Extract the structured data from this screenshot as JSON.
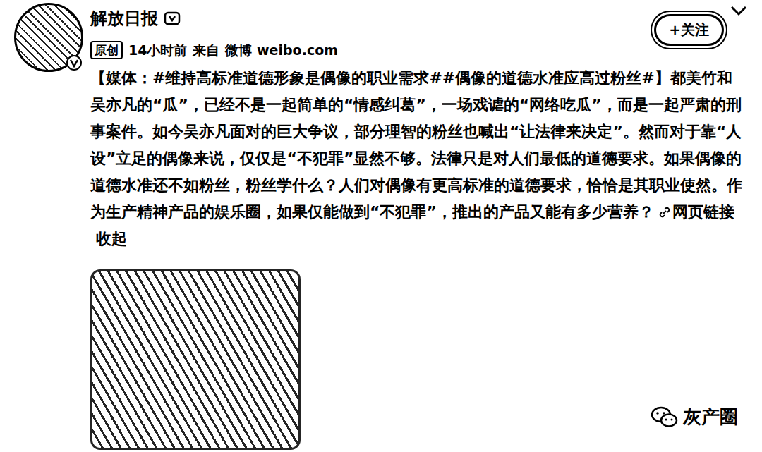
{
  "post": {
    "author": "解放日报",
    "source_tag": "原创",
    "time": "14小时前",
    "from_label": "来自",
    "client": "微博 weibo.com",
    "body": "【媒体：#维持高标准道德形象是偶像的职业需求##偶像的道德水准应高过粉丝#】都美竹和吴亦凡的“瓜”，已经不是一起简单的“情感纠葛”，一场戏谑的“网络吃瓜”，而是一起严肃的刑事案件。如今吴亦凡面对的巨大争议，部分理智的粉丝也喊出“让法律来决定”。然而对于靠“人设”立足的偶像来说，仅仅是“不犯罪”显然不够。法律只是对人们最低的道德要求。如果偶像的道德水准还不如粉丝，粉丝学什么？人们对偶像有更高标准的道德要求，恰恰是其职业使然。作为生产精神产品的娱乐圈，如果仅能做到“不犯罪”，推出的产品又能有多少营养？",
    "link_label": "网页链接",
    "collapse_label": "收起"
  },
  "follow_button": {
    "label": "+关注"
  },
  "watermark": "灰产圈"
}
